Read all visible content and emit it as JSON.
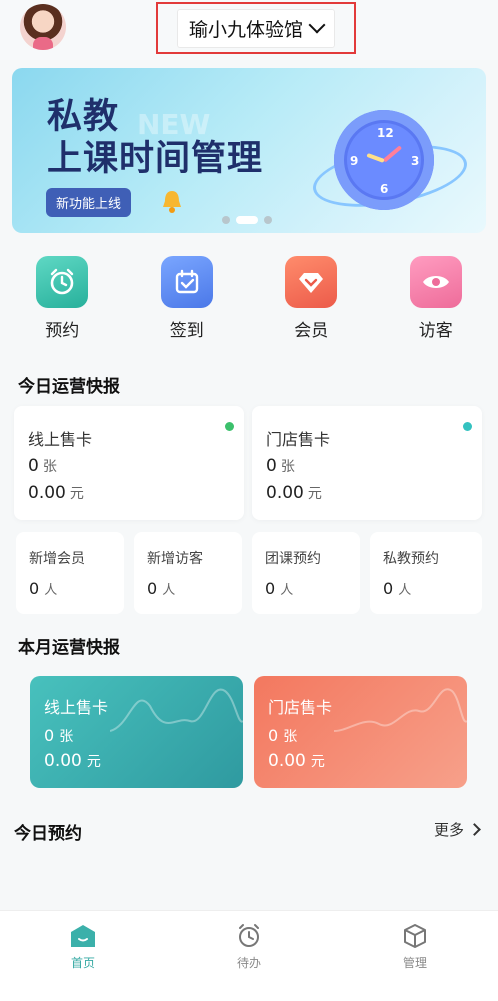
{
  "header": {
    "store_name": "瑜小九体验馆"
  },
  "banner": {
    "line1": "私教",
    "line2": "上课时间管理",
    "tag": "新功能上线",
    "clock_numbers": [
      "12",
      "3",
      "6",
      "9"
    ]
  },
  "quick_actions": [
    {
      "label": "预约",
      "icon": "alarm-clock-icon",
      "color": "#3cc3b0"
    },
    {
      "label": "签到",
      "icon": "calendar-check-icon",
      "color": "#5d8ef0"
    },
    {
      "label": "会员",
      "icon": "diamond-icon",
      "color": "#f26b5a"
    },
    {
      "label": "访客",
      "icon": "eye-icon",
      "color": "#f07ca7"
    }
  ],
  "today": {
    "title": "今日运营快报",
    "online": {
      "title": "线上售卡",
      "count": "0",
      "count_unit": "张",
      "amount": "0.00",
      "amount_unit": "元"
    },
    "store": {
      "title": "门店售卡",
      "count": "0",
      "count_unit": "张",
      "amount": "0.00",
      "amount_unit": "元"
    },
    "metrics": [
      {
        "title": "新增会员",
        "value": "0",
        "unit": "人"
      },
      {
        "title": "新增访客",
        "value": "0",
        "unit": "人"
      },
      {
        "title": "团课预约",
        "value": "0",
        "unit": "人"
      },
      {
        "title": "私教预约",
        "value": "0",
        "unit": "人"
      }
    ]
  },
  "month": {
    "title": "本月运营快报",
    "online": {
      "title": "线上售卡",
      "count": "0",
      "count_unit": "张",
      "amount": "0.00",
      "amount_unit": "元"
    },
    "store": {
      "title": "门店售卡",
      "count": "0",
      "count_unit": "张",
      "amount": "0.00",
      "amount_unit": "元"
    }
  },
  "appointments": {
    "title": "今日预约",
    "more": "更多"
  },
  "tabbar": [
    {
      "label": "首页",
      "icon": "home-icon",
      "active": true
    },
    {
      "label": "待办",
      "icon": "alarm-icon",
      "active": false
    },
    {
      "label": "管理",
      "icon": "cube-icon",
      "active": false
    }
  ]
}
